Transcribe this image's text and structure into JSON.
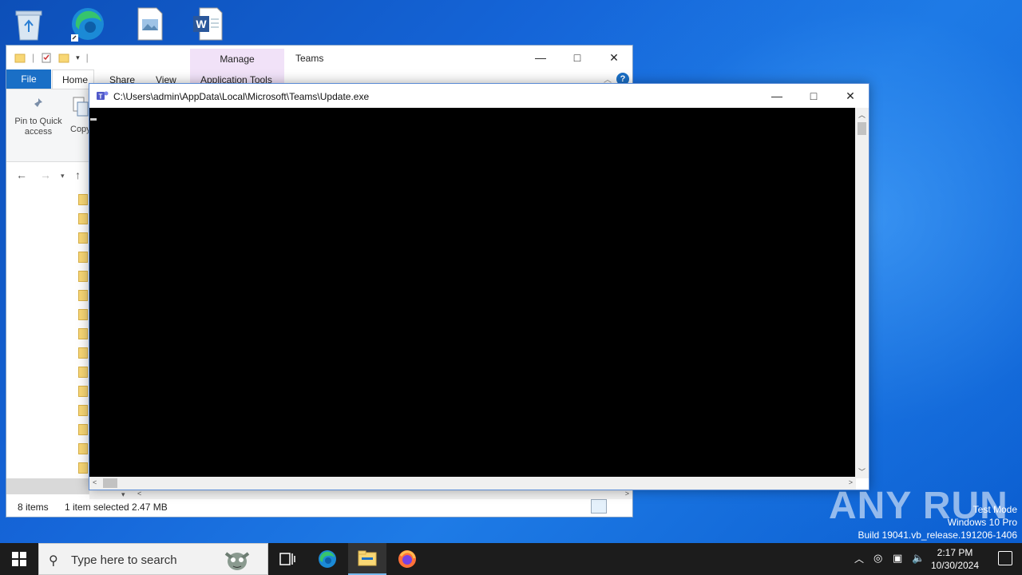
{
  "desktop": {
    "icons": [
      "recycle-bin-icon",
      "edge-icon",
      "image-file-icon",
      "word-document-icon"
    ]
  },
  "explorer": {
    "context_tab": "Manage",
    "title": "Teams",
    "tabs": {
      "file": "File",
      "home": "Home",
      "share": "Share",
      "view": "View",
      "app_tools": "Application Tools"
    },
    "ribbon": {
      "pin_label": "Pin to Quick access",
      "copy_label": "Copy"
    },
    "status": {
      "items": "8 items",
      "selected": "1 item selected  2.47 MB"
    }
  },
  "console": {
    "title": "C:\\Users\\admin\\AppData\\Local\\Microsoft\\Teams\\Update.exe"
  },
  "watermark": {
    "brand": "ANY RUN",
    "mode": "Test Mode",
    "os": "Windows 10 Pro",
    "build": "Build 19041.vb_release.191206-1406"
  },
  "taskbar": {
    "search_placeholder": "Type here to search",
    "time": "2:17 PM",
    "date": "10/30/2024"
  },
  "colors": {
    "accent": "#1a6fc6",
    "console_bg": "#000000",
    "taskbar": "#1c1c1c"
  }
}
